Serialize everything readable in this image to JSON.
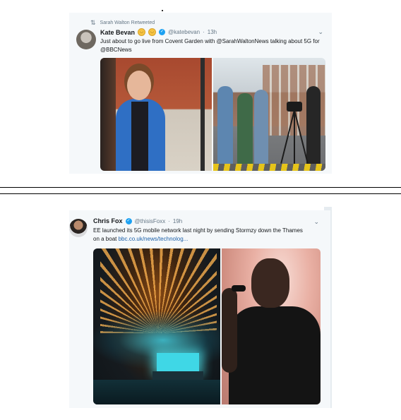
{
  "tweet1": {
    "retweet_label": "Sarah Walton Retweeted",
    "retweet_icon": "retweet-icon",
    "author_name": "Kate Bevan",
    "handle": "@katebevan",
    "time": "13h",
    "text": "Just about to go live from Covent Garden with @SarahWaltonNews talking about 5G for @BBCNews",
    "verified": true,
    "emojis": [
      "smiling-face-emoji",
      "smiling-face-emoji"
    ]
  },
  "tweet2": {
    "author_name": "Chris Fox",
    "handle": "@thisisFoxx",
    "time": "19h",
    "text": "EE launched its 5G mobile network last night by sending Stormzy down the Thames on a boat ",
    "link_text": "bbc.co.uk/news/technolog...",
    "verified": true
  },
  "colors": {
    "card_bg": "#f5f8fa",
    "link": "#1b5fa8",
    "verified": "#1da1f2",
    "muted": "#657786"
  }
}
